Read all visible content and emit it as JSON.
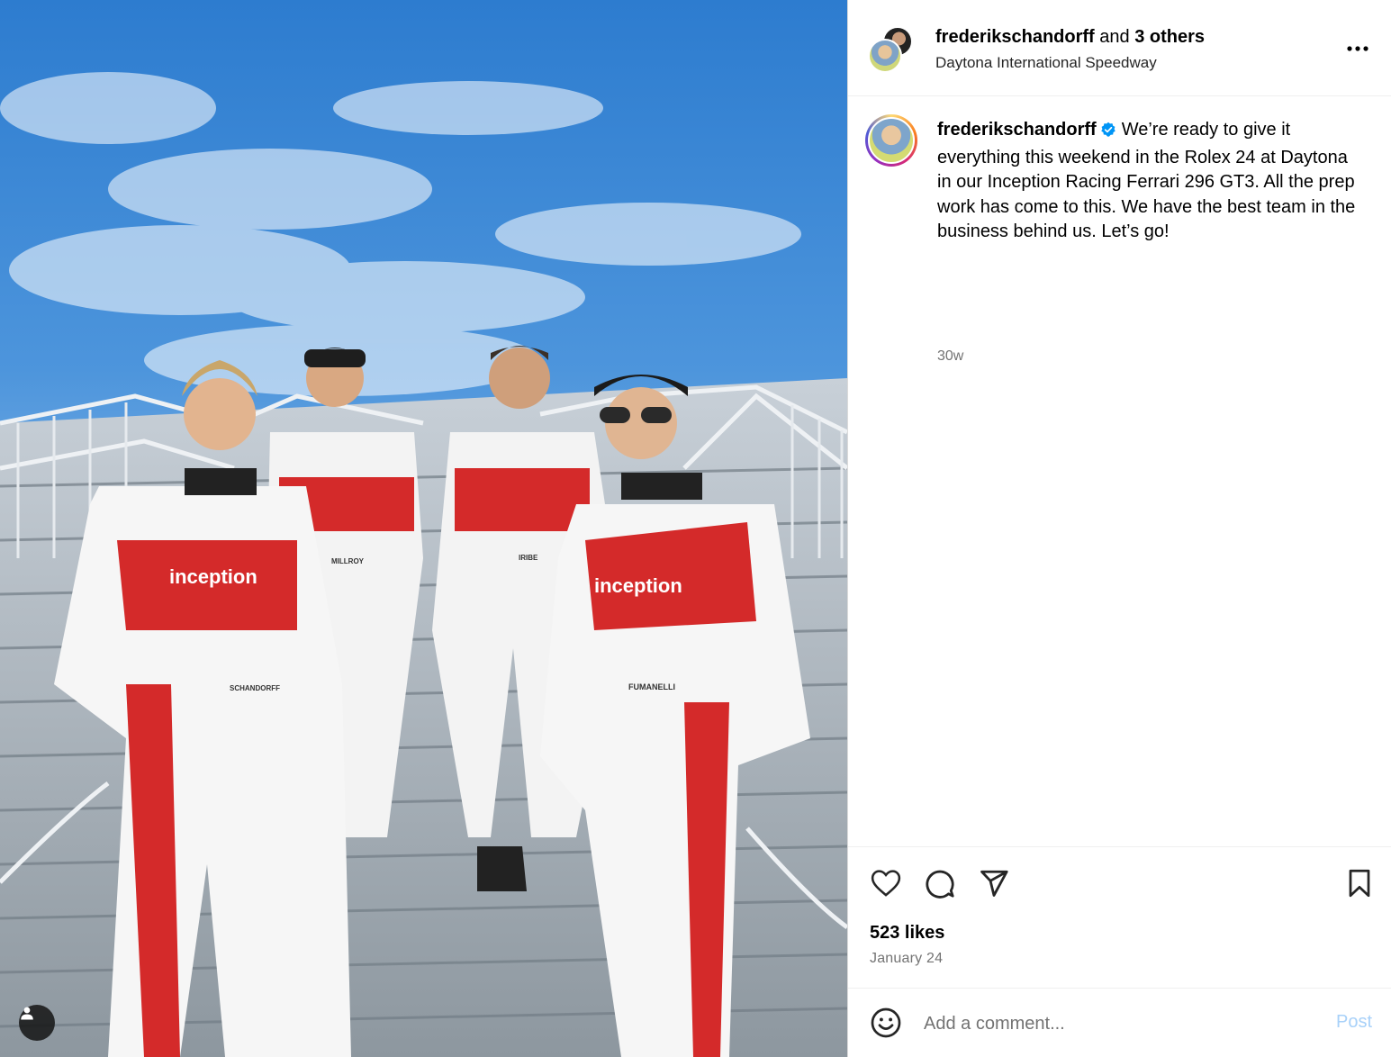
{
  "post": {
    "header": {
      "username": "frederikschandorff",
      "and_text": "and",
      "others": "3 others",
      "location": "Daytona International Speedway"
    },
    "caption": {
      "username": "frederikschandorff",
      "text": "We’re ready to give it everything this weekend in the Rolex 24 at Daytona in our Inception Racing Ferrari 296 GT3. All the prep work has come to this. We have the best team in the business behind us. Let’s go!",
      "time_ago": "30w"
    },
    "likes": "523 likes",
    "date": "January 24",
    "comment": {
      "placeholder": "Add a comment...",
      "post_label": "Post"
    },
    "photo": {
      "suit_names": [
        "SCHANDORFF",
        "MILLROY",
        "IRIBE",
        "FUMANELLI"
      ],
      "suit_brand": "inception"
    }
  },
  "icons": {
    "more": "more-options-icon",
    "verified": "verified-badge-icon",
    "like": "heart-icon",
    "comment": "comment-icon",
    "share": "share-icon",
    "save": "bookmark-icon",
    "emoji": "emoji-icon",
    "tag_user": "user-icon"
  },
  "colors": {
    "verified": "#0095f6",
    "post_disabled": "#a8d1f9",
    "secondary_text": "#737373",
    "suit_red": "#d42a2a"
  }
}
